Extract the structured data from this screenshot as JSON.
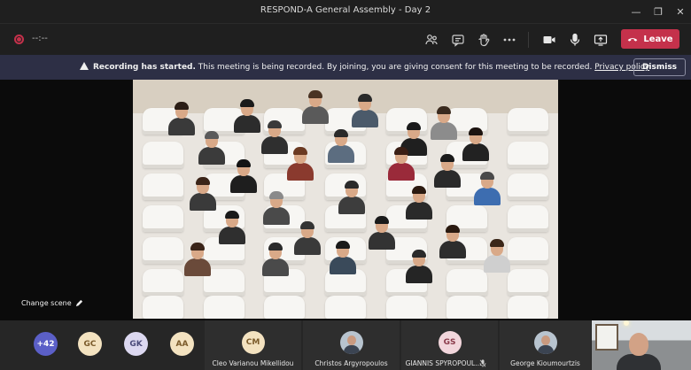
{
  "window": {
    "title": "RESPOND-A General Assembly - Day 2"
  },
  "toolbar": {
    "timer": "--:--",
    "leave_label": "Leave"
  },
  "banner": {
    "heading": "Recording has started.",
    "message": " This meeting is being recorded. By joining, you are giving consent for this meeting to be recorded. ",
    "link": "Privacy policy",
    "dismiss_label": "Dismiss"
  },
  "scene": {
    "change_label": "Change scene"
  },
  "participants": {
    "overflow": "+42",
    "avatars": [
      {
        "initials": "GC",
        "color": "#f3e2c0"
      },
      {
        "initials": "GK",
        "color": "#dcd8f0"
      },
      {
        "initials": "AA",
        "color": "#f3e2c0"
      }
    ],
    "tiles": [
      {
        "initials": "CM",
        "name": "Cleo Varianou Mikellidou"
      },
      {
        "initials": "",
        "name": "Christos Argyropoulos"
      },
      {
        "initials": "GS",
        "name": "GIANNIS SPYROPOUL..."
      },
      {
        "initials": "",
        "name": "George Kioumourtzis"
      }
    ]
  },
  "colors": {
    "leave": "#c4314b",
    "banner": "#2d2f45",
    "accent": "#5b5fc7"
  }
}
